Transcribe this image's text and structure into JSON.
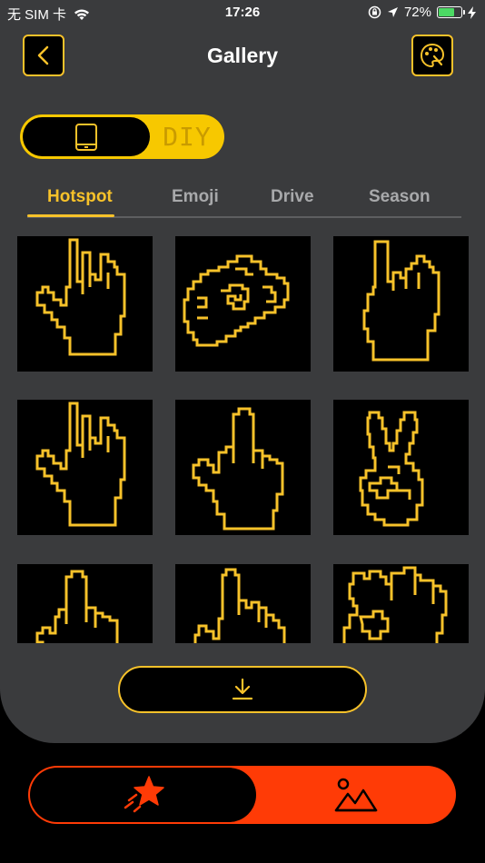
{
  "status_bar": {
    "carrier": "无 SIM 卡",
    "time": "17:26",
    "battery": "72%",
    "battery_level": 0.72,
    "icons": [
      "wifi-icon",
      "orientation-lock-icon",
      "location-icon",
      "battery-icon",
      "charging-icon"
    ]
  },
  "header": {
    "title": "Gallery",
    "back_icon": "chevron-left-icon",
    "right_icon": "palette-icon"
  },
  "mode_toggle": {
    "selected": "device",
    "device_icon": "tablet-icon",
    "diy_label": "DIY"
  },
  "tabs": [
    {
      "label": "Hotspot",
      "active": true
    },
    {
      "label": "Emoji",
      "active": false
    },
    {
      "label": "Drive",
      "active": false
    },
    {
      "label": "Season",
      "active": false
    }
  ],
  "gallery": {
    "items": [
      {
        "icon": "rock-hand-icon"
      },
      {
        "icon": "fist-icon"
      },
      {
        "icon": "rock-hand-icon"
      },
      {
        "icon": "rock-hand-icon"
      },
      {
        "icon": "middle-finger-icon"
      },
      {
        "icon": "peace-sign-icon"
      },
      {
        "icon": "middle-finger-icon"
      },
      {
        "icon": "rock-hand-icon"
      },
      {
        "icon": "ok-hand-icon"
      }
    ]
  },
  "download_button": {
    "icon": "download-icon"
  },
  "bottom_nav": {
    "items": [
      {
        "icon": "star-icon",
        "selected": true
      },
      {
        "icon": "image-icon",
        "selected": false
      }
    ]
  },
  "colors": {
    "accent": "#f7c22a",
    "panel": "#3a3b3d",
    "nav_accent": "#ff3b06",
    "background": "#000000"
  }
}
